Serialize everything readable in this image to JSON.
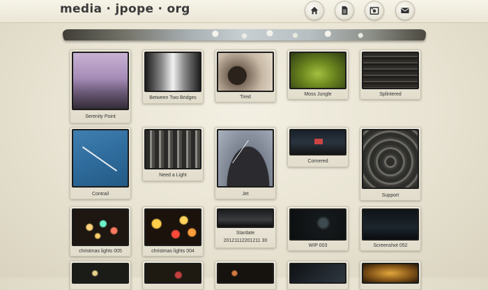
{
  "site": {
    "logo": "media · jpope · org"
  },
  "nav": [
    {
      "name": "home-icon"
    },
    {
      "name": "document-icon"
    },
    {
      "name": "camera-icon"
    },
    {
      "name": "mail-icon"
    }
  ],
  "gallery": {
    "items": [
      {
        "caption": "Serenity Point"
      },
      {
        "caption": "Between Two Bridges"
      },
      {
        "caption": "Tired"
      },
      {
        "caption": "Moss Jungle"
      },
      {
        "caption": "Splintered"
      },
      {
        "caption": "Contrail"
      },
      {
        "caption": "Need a Light"
      },
      {
        "caption": "Jet"
      },
      {
        "caption": "Cornered"
      },
      {
        "caption": "Support"
      },
      {
        "caption": "christmas lights 005"
      },
      {
        "caption": "christmas lights 004"
      },
      {
        "caption": "Stardate",
        "subcaption": "20121112201211 30"
      },
      {
        "caption": "WIP 003"
      },
      {
        "caption": "Screenshot 052"
      }
    ]
  }
}
